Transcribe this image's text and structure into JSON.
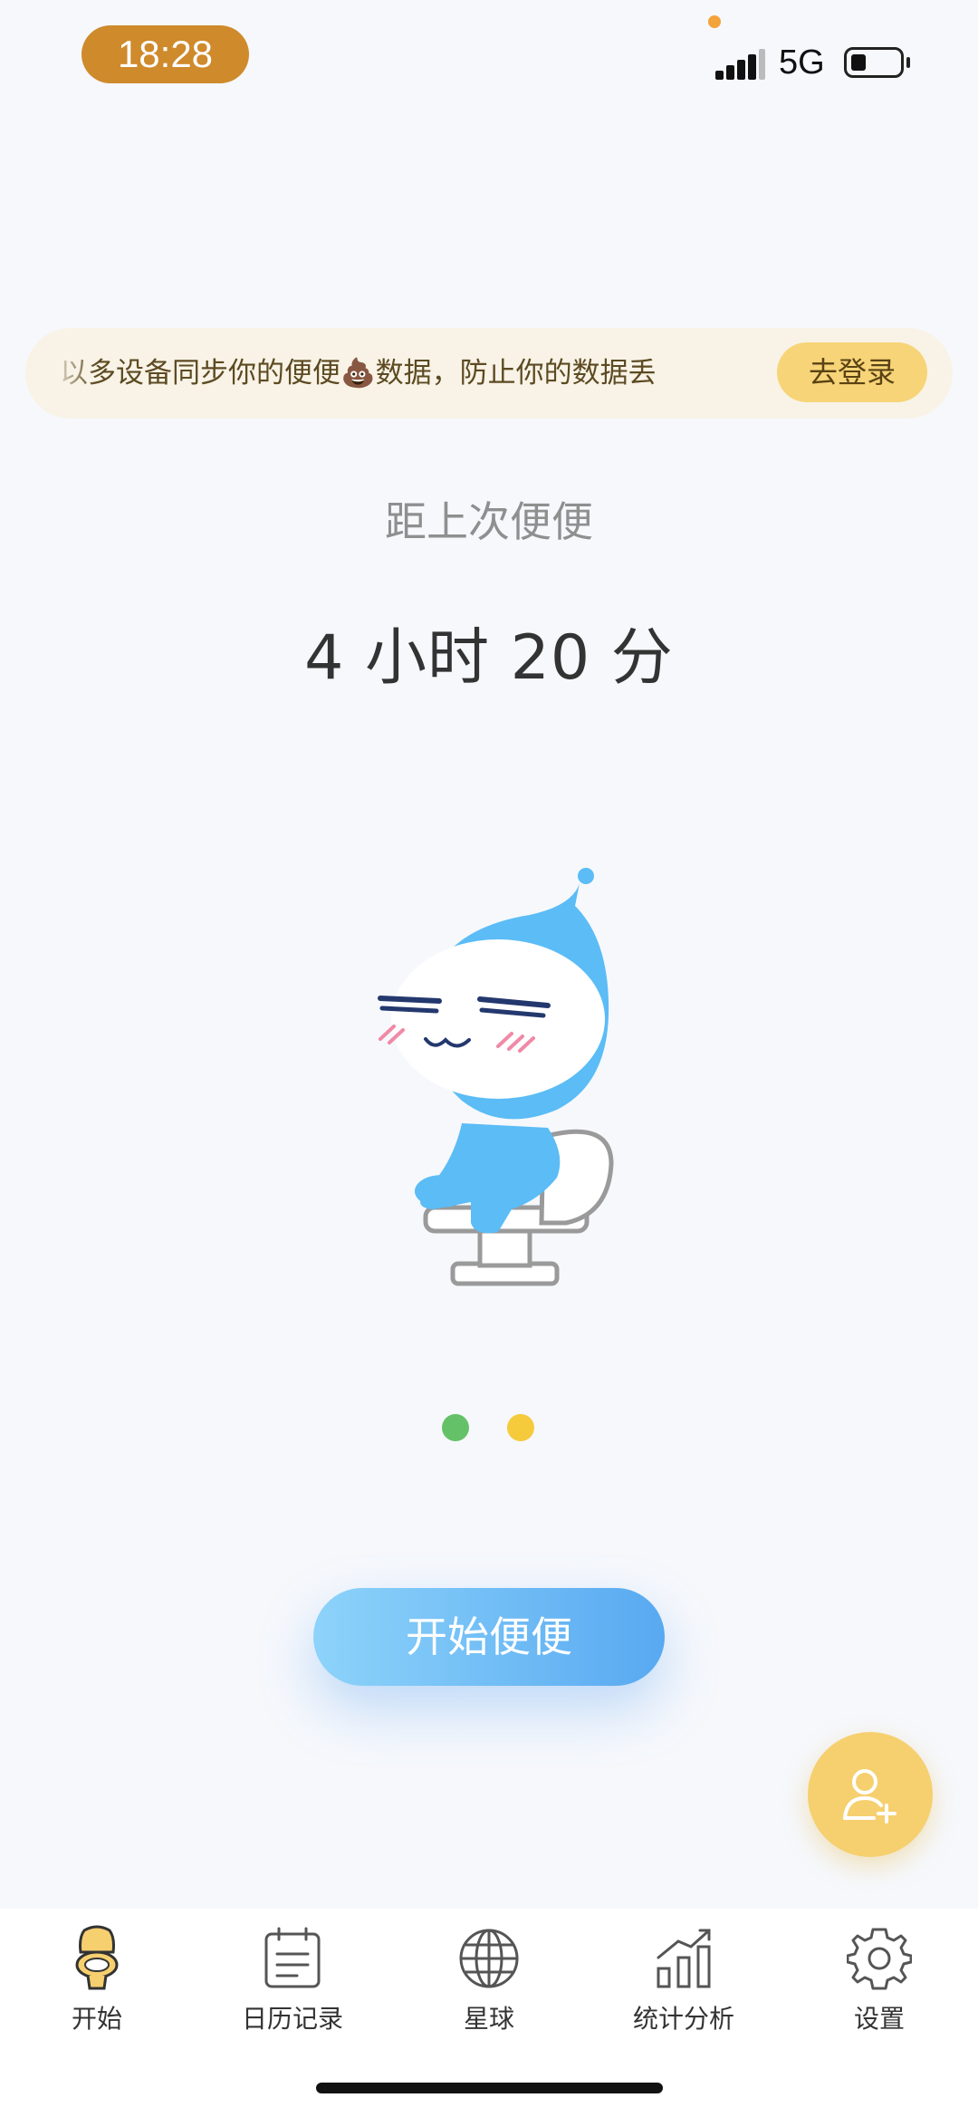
{
  "status_bar": {
    "time": "18:28",
    "network": "5G"
  },
  "banner": {
    "text": "以多设备同步你的便便💩数据，防止你的数据丢",
    "login_label": "去登录"
  },
  "timer": {
    "label": "距上次便便",
    "elapsed": "4 小时 20 分"
  },
  "pager": {
    "dot_colors": [
      "#65c168",
      "#f5cb3c"
    ]
  },
  "start_button": {
    "label": "开始便便"
  },
  "tabs": [
    {
      "label": "开始",
      "icon": "toilet-icon"
    },
    {
      "label": "日历记录",
      "icon": "calendar-icon"
    },
    {
      "label": "星球",
      "icon": "globe-icon"
    },
    {
      "label": "统计分析",
      "icon": "chart-icon"
    },
    {
      "label": "设置",
      "icon": "gear-icon"
    }
  ],
  "colors": {
    "accent": "#f6cf6f",
    "primary_gradient": [
      "#8dd3fa",
      "#58a9f1"
    ],
    "time_pill": "#cf8a2c"
  }
}
